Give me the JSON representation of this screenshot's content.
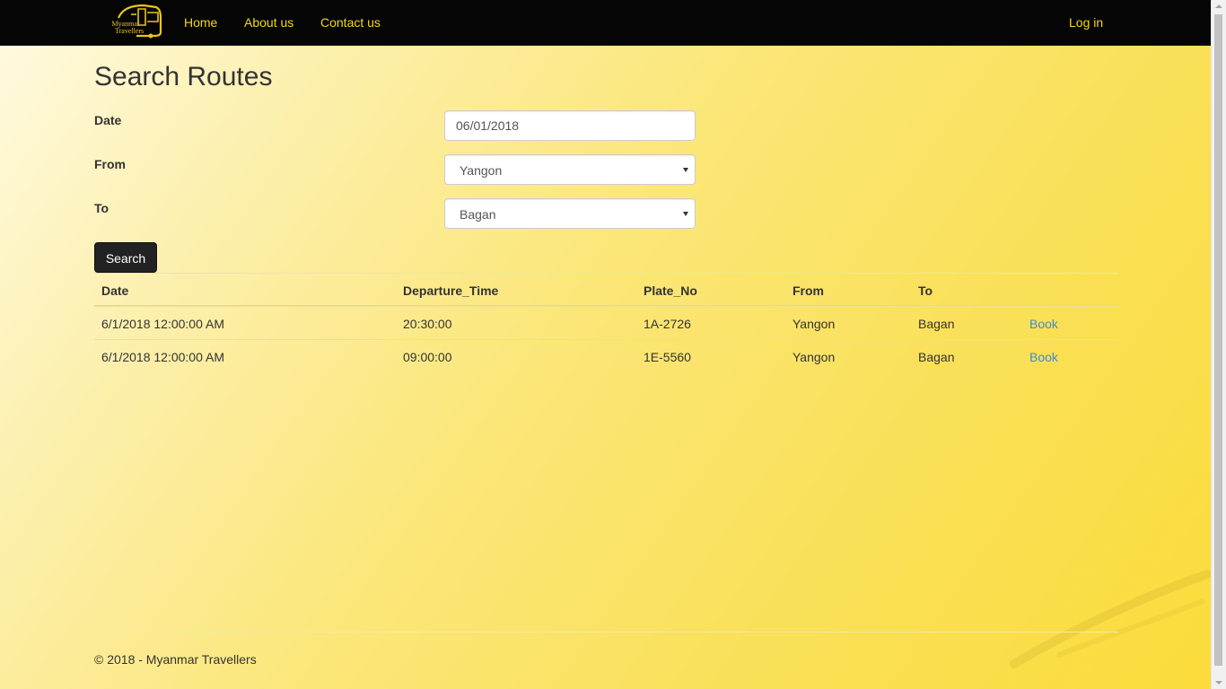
{
  "navbar": {
    "brand": {
      "line1": "Myanmar",
      "line2": "Travellers",
      "icon": "bus-logo-icon"
    },
    "links": [
      "Home",
      "About us",
      "Contact us"
    ],
    "login": "Log in"
  },
  "page": {
    "title": "Search Routes"
  },
  "form": {
    "date_label": "Date",
    "date_value": "06/01/2018",
    "from_label": "From",
    "from_value": "Yangon",
    "to_label": "To",
    "to_value": "Bagan",
    "search_label": "Search"
  },
  "table": {
    "headers": [
      "Date",
      "Departure_Time",
      "Plate_No",
      "From",
      "To"
    ],
    "rows": [
      {
        "date": "6/1/2018 12:00:00 AM",
        "time": "20:30:00",
        "plate": "1A-2726",
        "from": "Yangon",
        "to": "Bagan",
        "action": "Book"
      },
      {
        "date": "6/1/2018 12:00:00 AM",
        "time": "09:00:00",
        "plate": "1E-5560",
        "from": "Yangon",
        "to": "Bagan",
        "action": "Book"
      }
    ]
  },
  "footer": {
    "text": "© 2018 - Myanmar Travellers"
  },
  "colors": {
    "navbar_bg": "#050505",
    "nav_link": "#f5d90a",
    "link": "#428bca",
    "button_bg": "#222222",
    "background_accent": "#fbdc3a"
  }
}
